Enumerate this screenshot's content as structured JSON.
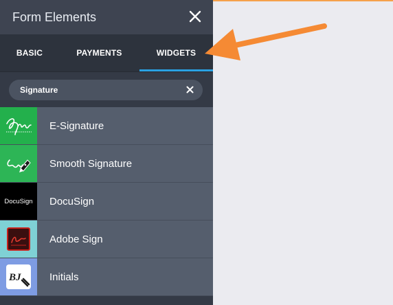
{
  "panel": {
    "title": "Form Elements"
  },
  "tabs": [
    {
      "label": "BASIC",
      "active": false
    },
    {
      "label": "PAYMENTS",
      "active": false
    },
    {
      "label": "WIDGETS",
      "active": true
    }
  ],
  "search": {
    "value": "Signature"
  },
  "items": [
    {
      "label": "E-Signature",
      "icon": "e-signature-icon",
      "color": "#23b04c"
    },
    {
      "label": "Smooth Signature",
      "icon": "smooth-signature-icon",
      "color": "#2db556"
    },
    {
      "label": "DocuSign",
      "icon": "docusign-logo",
      "icon_text": "DocuSign",
      "color": "#000000"
    },
    {
      "label": "Adobe Sign",
      "icon": "adobe-sign-icon",
      "color": "#7fd1d5"
    },
    {
      "label": "Initials",
      "icon": "initials-icon",
      "color": "#7e9ce3"
    }
  ],
  "colors": {
    "accent_tab": "#2aa1e3",
    "arrow": "#f58a34",
    "panel_bg": "#343a46"
  }
}
